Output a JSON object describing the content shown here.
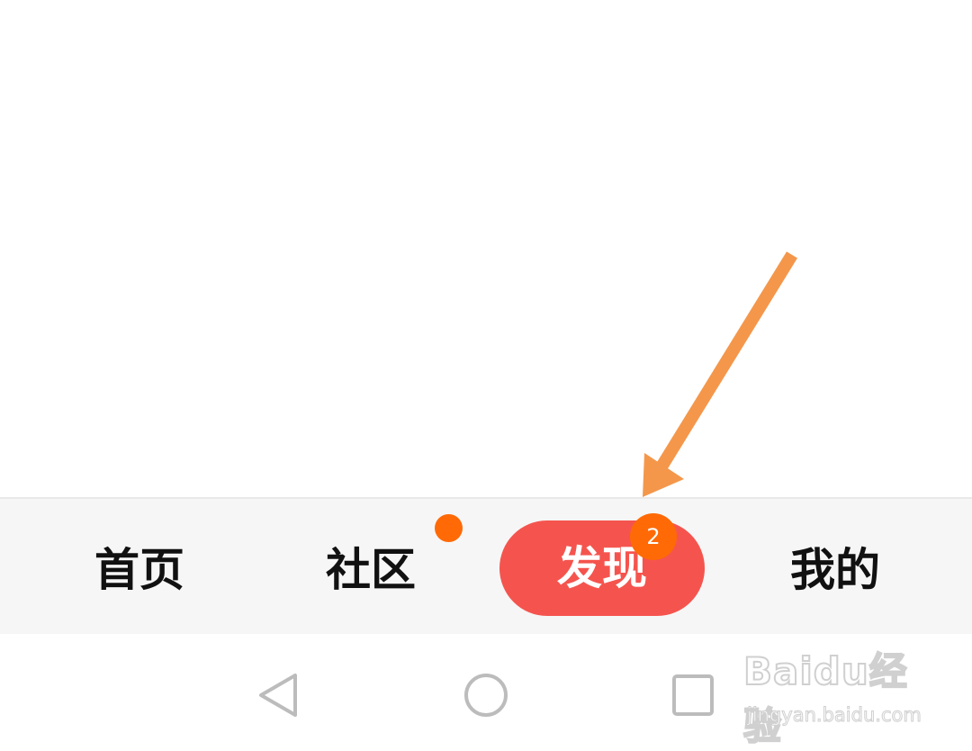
{
  "tabs": [
    {
      "label": "首页"
    },
    {
      "label": "社区"
    },
    {
      "label": "发现"
    },
    {
      "label": "我的"
    }
  ],
  "badges": {
    "discover_count": "2"
  },
  "watermark": {
    "logo": "Baidu经验",
    "url": "jingyan.baidu.com"
  },
  "colors": {
    "active_tab_bg": "#f5544e",
    "badge": "#ff6a06",
    "arrow": "#f4974b",
    "tab_bar_bg": "#f6f6f6",
    "nav_icon": "#bcbcbc"
  },
  "icons": {
    "back": "triangle-back-icon",
    "home": "circle-home-icon",
    "recent": "square-recent-icon",
    "arrow": "arrow-annotation-icon"
  }
}
